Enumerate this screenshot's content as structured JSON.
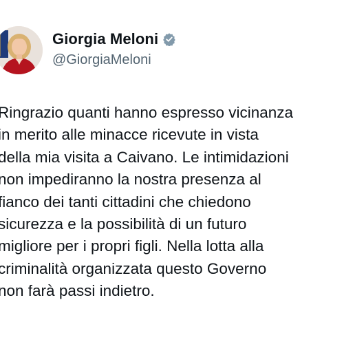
{
  "author": {
    "display_name": "Giorgia Meloni",
    "handle": "@GiorgiaMeloni",
    "verified_icon": "verified-badge-icon",
    "verified_color": "#829aab"
  },
  "tweet": {
    "lines": [
      "Ringrazio quanti hanno espresso vicinanza",
      "in merito alle minacce ricevute in vista",
      "della mia visita a Caivano. Le intimidazioni",
      "non impediranno la nostra presenza al",
      "fianco dei tanti cittadini che chiedono",
      "sicurezza e la possibilità di un futuro",
      "migliore per i propri figli. Nella lotta alla",
      "criminalità organizzata questo Governo",
      "non farà passi indietro."
    ]
  }
}
